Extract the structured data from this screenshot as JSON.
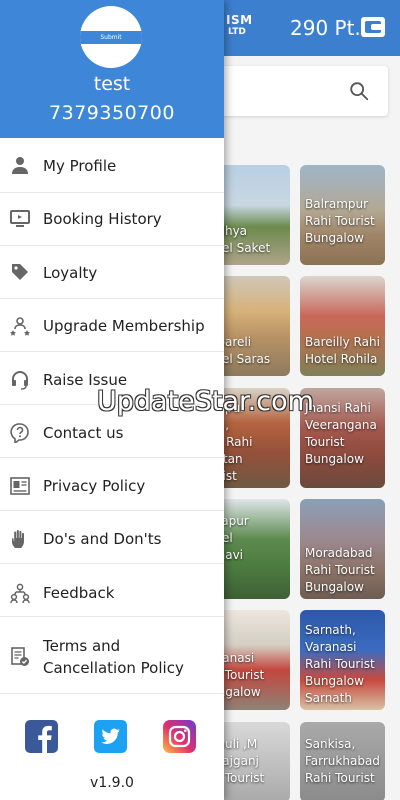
{
  "app": {
    "brand_line1": "ISM",
    "brand_line2": "LTD",
    "points": "290 Pt."
  },
  "drawer": {
    "avatar_text": "Submit",
    "user_name": "test",
    "user_phone": "7379350700",
    "items": [
      {
        "label": "My Profile",
        "icon": "person-icon"
      },
      {
        "label": "Booking History",
        "icon": "monitor-icon"
      },
      {
        "label": "Loyalty",
        "icon": "tag-icon"
      },
      {
        "label": "Upgrade Membership",
        "icon": "group-stars-icon"
      },
      {
        "label": "Raise Issue",
        "icon": "headset-icon"
      },
      {
        "label": "Contact us",
        "icon": "question-bubble-icon"
      },
      {
        "label": "Privacy Policy",
        "icon": "id-card-icon"
      },
      {
        "label": "Do's and Don'ts",
        "icon": "hand-icon"
      },
      {
        "label": "Feedback",
        "icon": "people-network-icon"
      },
      {
        "label": "Terms and",
        "label2": "Cancellation Policy",
        "icon": "document-check-icon"
      }
    ],
    "version": "v1.9.0"
  },
  "hotels": [
    {
      "line1": "odhya",
      "line2": "otel Saket"
    },
    {
      "line1": "Balrampur",
      "line2": "Rahi Tourist",
      "line3": "Bungalow"
    },
    {
      "line1": "ebareli",
      "line2": "otel Saras"
    },
    {
      "line1": "Bareilly Rahi",
      "line2": "Hotel Rohila"
    },
    {
      "line1": "ehpur",
      "line2": "kri,",
      "line3": "ra Rahi",
      "line4": "listan",
      "line5": "urist"
    },
    {
      "line1": "Jhansi Rahi",
      "line2": "Veerangana",
      "line3": "Tourist",
      "line4": "Bungalow"
    },
    {
      "line1": "rzapur",
      "line2": "otel",
      "line3": "nnavi"
    },
    {
      "line1": "Moradabad",
      "line2": "Rahi Tourist",
      "line3": "Bungalow"
    },
    {
      "line1": "aranasi",
      "line2": "hi Tourist",
      "line3": "ungalow"
    },
    {
      "line1": "Sarnath,",
      "line2": "Varanasi",
      "line3": "Rahi Tourist",
      "line4": "Bungalow",
      "line5": "Sarnath"
    },
    {
      "line1": "nauli ,M",
      "line2": "arajganj",
      "line3": "hi Tourist"
    },
    {
      "line1": "Sankisa,",
      "line2": "Farrukhabad",
      "line3": "Rahi Tourist"
    }
  ],
  "watermark": "UpdateStar.com"
}
